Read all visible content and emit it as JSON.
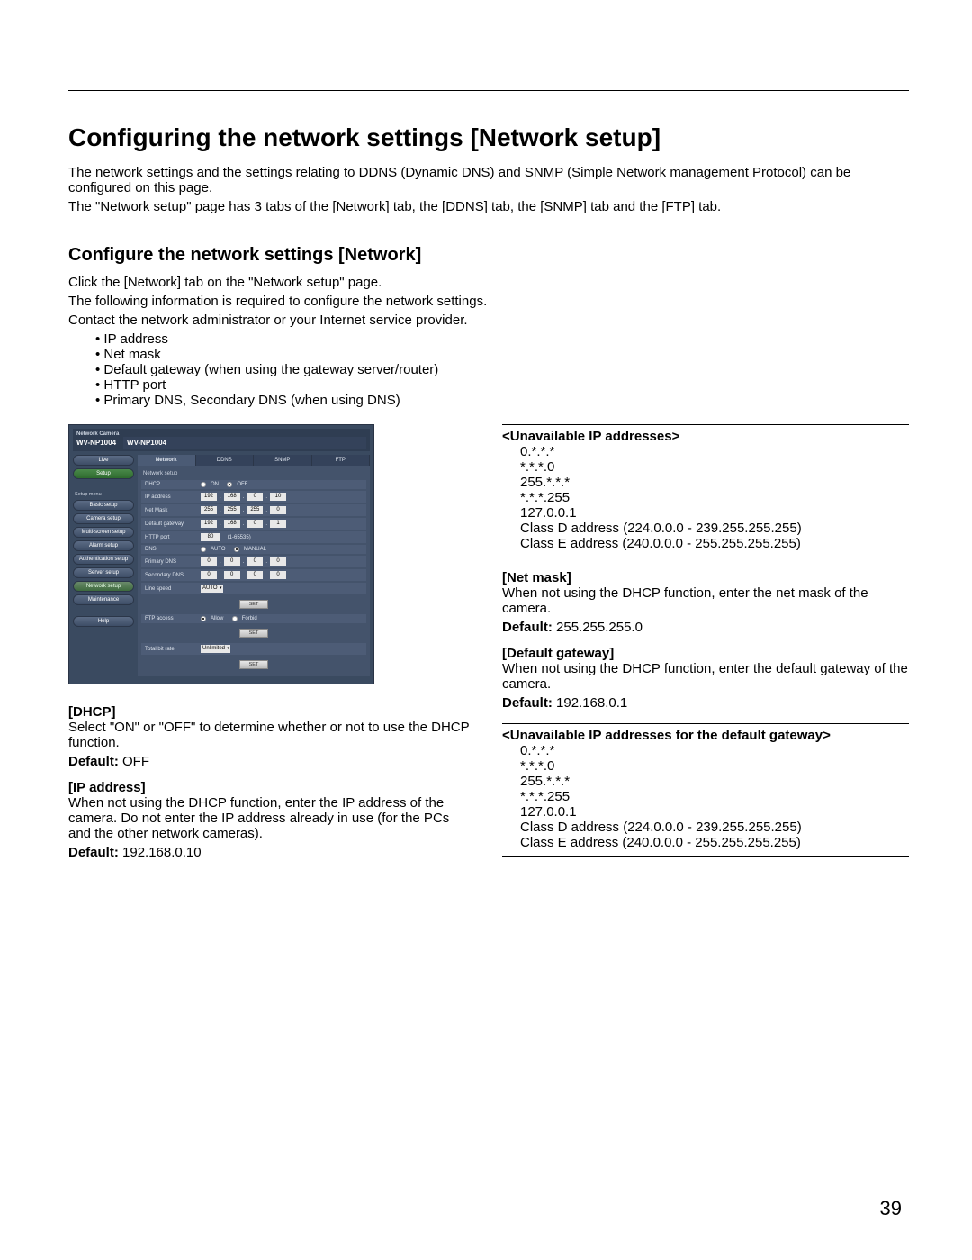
{
  "page_number": "39",
  "h1": "Configuring the network settings [Network setup]",
  "intro": [
    "The network settings and the settings relating to DDNS (Dynamic DNS) and SNMP (Simple Network management Protocol) can be configured on this page.",
    "The \"Network setup\" page has 3 tabs of the [Network] tab, the [DDNS] tab, the [SNMP] tab and the [FTP] tab."
  ],
  "h2": "Configure the network settings [Network]",
  "sub_intro": [
    "Click the [Network] tab on the \"Network setup\" page.",
    "The following information is required to configure the network settings.",
    "Contact the network administrator or your Internet service provider."
  ],
  "bullets": [
    "IP address",
    "Net mask",
    "Default gateway (when using the gateway server/router)",
    "HTTP port",
    "Primary DNS, Secondary DNS (when using DNS)"
  ],
  "ui": {
    "brand_small": "Network Camera",
    "brand": "WV-NP1004",
    "title": "WV-NP1004",
    "sidebar": {
      "live": "Live",
      "setup": "Setup",
      "menu": "Setup menu",
      "items": [
        "Basic setup",
        "Camera setup",
        "Multi-screen setup",
        "Alarm setup",
        "Authentication setup",
        "Server setup",
        "Network setup",
        "Maintenance"
      ],
      "help": "Help"
    },
    "tabs": [
      "Network",
      "DDNS",
      "SNMP",
      "FTP"
    ],
    "section": "Network setup",
    "rows": {
      "dhcp": {
        "label": "DHCP",
        "on": "ON",
        "off": "OFF"
      },
      "ip": {
        "label": "IP address",
        "o1": "192",
        "o2": "168",
        "o3": "0",
        "o4": "10"
      },
      "mask": {
        "label": "Net Mask",
        "o1": "255",
        "o2": "255",
        "o3": "255",
        "o4": "0"
      },
      "gw": {
        "label": "Default gateway",
        "o1": "192",
        "o2": "168",
        "o3": "0",
        "o4": "1"
      },
      "http": {
        "label": "HTTP port",
        "val": "80",
        "hint": "(1-65535)"
      },
      "dns": {
        "label": "DNS",
        "auto": "AUTO",
        "manual": "MANUAL"
      },
      "pdns": {
        "label": "Primary DNS",
        "o1": "0",
        "o2": "0",
        "o3": "0",
        "o4": "0"
      },
      "sdns": {
        "label": "Secondary DNS",
        "o1": "0",
        "o2": "0",
        "o3": "0",
        "o4": "0"
      },
      "line": {
        "label": "Line speed",
        "val": "AUTO"
      },
      "ftp": {
        "label": "FTP access",
        "allow": "Allow",
        "forbid": "Forbid"
      },
      "total": {
        "label": "Total bit rate",
        "val": "Unlimited"
      }
    },
    "set": "SET"
  },
  "left": {
    "dhcp_h": "[DHCP]",
    "dhcp_t": "Select \"ON\" or \"OFF\" to determine whether or not to use the DHCP function.",
    "dhcp_d_label": "Default:",
    "dhcp_d_val": " OFF",
    "ip_h": "[IP address]",
    "ip_t": "When not using the DHCP function, enter the IP address of the camera. Do not enter the IP address already in use (for the PCs and the other network cameras).",
    "ip_d_label": "Default:",
    "ip_d_val": " 192.168.0.10"
  },
  "right": {
    "unavail_h": "<Unavailable IP addresses>",
    "unavail_list": [
      "0.*.*.*",
      "*.*.*.0",
      "255.*.*.*",
      "*.*.*.255",
      "127.0.0.1",
      "Class D address (224.0.0.0 - 239.255.255.255)",
      "Class E address (240.0.0.0 - 255.255.255.255)"
    ],
    "mask_h": "[Net mask]",
    "mask_t": "When not using the DHCP function, enter the net mask of the camera.",
    "mask_d_label": "Default:",
    "mask_d_val": " 255.255.255.0",
    "gw_h": "[Default gateway]",
    "gw_t": "When not using the DHCP function, enter the default gateway of the camera.",
    "gw_d_label": "Default:",
    "gw_d_val": " 192.168.0.1",
    "unavail_gw_h": "<Unavailable IP addresses for the default gateway>",
    "unavail_gw_list": [
      "0.*.*.*",
      "*.*.*.0",
      "255.*.*.*",
      "*.*.*.255",
      "127.0.0.1",
      "Class D address (224.0.0.0 - 239.255.255.255)",
      "Class E address (240.0.0.0 - 255.255.255.255)"
    ]
  }
}
